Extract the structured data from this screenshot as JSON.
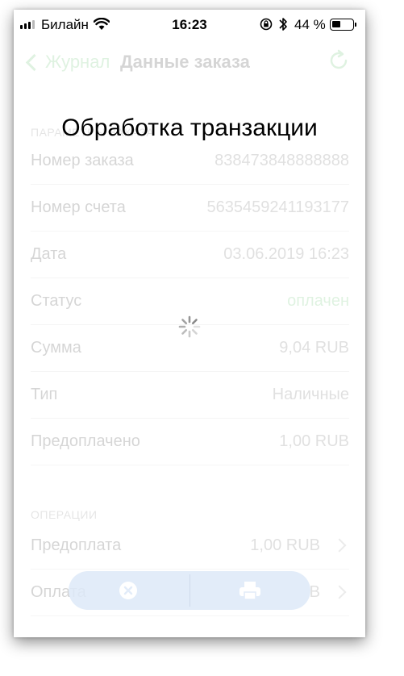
{
  "status_bar": {
    "carrier": "Билайн",
    "time": "16:23",
    "battery_percent": "44 %",
    "battery_level": 0.44
  },
  "nav": {
    "back_label": "Журнал",
    "title": "Данные заказа"
  },
  "sections": {
    "params_header": "ПАРАМЕТРЫ ЗАКАЗА",
    "operations_header": "ОПЕРАЦИИ"
  },
  "order_rows": [
    {
      "label": "Номер заказа",
      "value": "838473848888888"
    },
    {
      "label": "Номер счета",
      "value": "5635459241193177"
    },
    {
      "label": "Дата",
      "value": "03.06.2019 16:23"
    },
    {
      "label": "Статус",
      "value": "оплачен"
    },
    {
      "label": "Сумма",
      "value": "9,04 RUB"
    },
    {
      "label": "Тип",
      "value": "Наличные"
    },
    {
      "label": "Предоплачено",
      "value": "1,00 RUB"
    }
  ],
  "operation_rows": [
    {
      "label": "Предоплата",
      "value": "1,00 RUB"
    },
    {
      "label": "Оплата",
      "value": "B"
    }
  ],
  "overlay": {
    "title": "Обработка транзакции"
  },
  "colors": {
    "accent_green": "#3cb34a",
    "action_bar": "#dde9f8"
  },
  "icons": {
    "cancel": "close-circle-icon",
    "print": "printer-icon",
    "refresh": "refresh-icon"
  }
}
